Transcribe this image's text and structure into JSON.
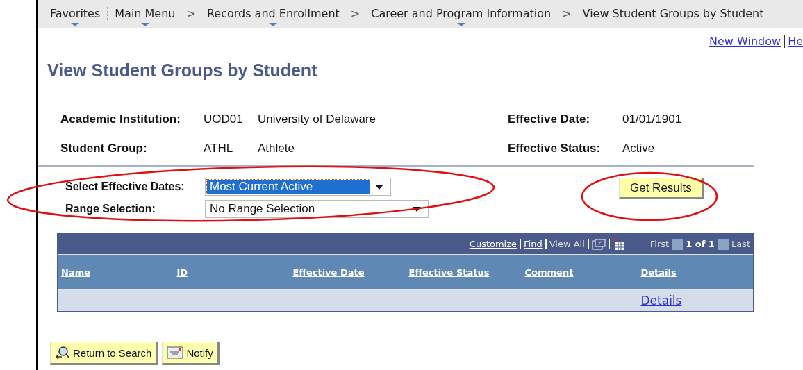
{
  "breadcrumb": [
    {
      "label": "Favorites",
      "menu": true
    },
    {
      "label": "Main Menu",
      "menu": true
    },
    {
      "label": "Records and Enrollment",
      "menu": true
    },
    {
      "label": "Career and Program Information",
      "menu": true
    },
    {
      "label": "View Student Groups by Student",
      "menu": false
    }
  ],
  "breadcrumb_separator": ">",
  "top_links": [
    "New Window",
    "He"
  ],
  "title": "View Student Groups by Student",
  "fields_left": [
    {
      "label": "Academic Institution:",
      "code": "UOD01",
      "value": "University of Delaware"
    },
    {
      "label": "Student Group:",
      "code": "ATHL",
      "value": "Athlete"
    }
  ],
  "fields_right": [
    {
      "label": "Effective Date:",
      "value": "01/01/1901"
    },
    {
      "label": "Effective Status:",
      "value": "Active"
    }
  ],
  "selects": [
    {
      "label": "Select Effective Dates:",
      "value": "Most Current Active",
      "focused": true
    },
    {
      "label": "Range Selection:",
      "value": "No Range Selection",
      "focused": false
    }
  ],
  "get_results": "Get Results",
  "grid": {
    "toolbar": {
      "customize": "Customize",
      "find": "Find",
      "view_all": "View All",
      "first": "First",
      "count": "1 of 1",
      "last": "Last"
    },
    "columns": [
      "Name",
      "ID",
      "Effective Date",
      "Effective Status",
      "Comment",
      "Details"
    ],
    "rows": [
      [
        "",
        "",
        "",
        "",
        "",
        "Details"
      ]
    ]
  },
  "buttons": [
    {
      "kind": "search",
      "label": "Return to Search"
    },
    {
      "kind": "notify",
      "label": "Notify"
    }
  ],
  "annotations": [
    {
      "kind": "ellipse",
      "color": "#e01010"
    },
    {
      "kind": "ellipse",
      "color": "#e01010"
    }
  ]
}
